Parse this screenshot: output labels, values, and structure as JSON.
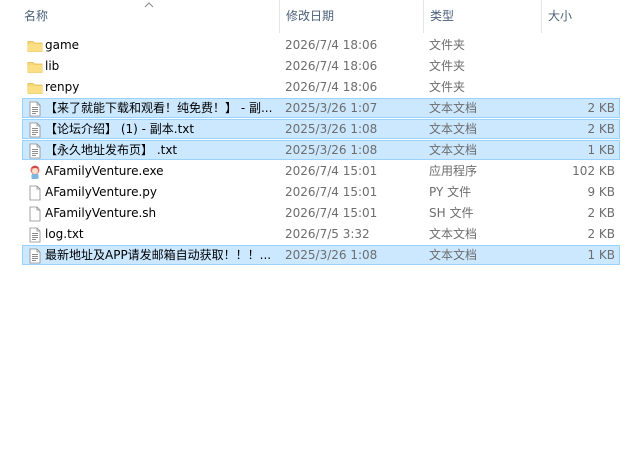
{
  "columns": {
    "name": "名称",
    "date": "修改日期",
    "type": "类型",
    "size": "大小"
  },
  "files": [
    {
      "name": "game",
      "date": "2026/7/4 18:06",
      "type": "文件夹",
      "size": "",
      "icon": "folder-icon",
      "selected": false
    },
    {
      "name": "lib",
      "date": "2026/7/4 18:06",
      "type": "文件夹",
      "size": "",
      "icon": "folder-icon",
      "selected": false
    },
    {
      "name": "renpy",
      "date": "2026/7/4 18:06",
      "type": "文件夹",
      "size": "",
      "icon": "folder-icon",
      "selected": false
    },
    {
      "name": "【来了就能下载和观看！纯免费！】 - 副...",
      "date": "2025/3/26 1:07",
      "type": "文本文档",
      "size": "2 KB",
      "icon": "text-file-icon",
      "selected": true
    },
    {
      "name": "【论坛介绍】 (1) - 副本.txt",
      "date": "2025/3/26 1:08",
      "type": "文本文档",
      "size": "2 KB",
      "icon": "text-file-icon",
      "selected": true
    },
    {
      "name": "【永久地址发布页】 .txt",
      "date": "2025/3/26 1:08",
      "type": "文本文档",
      "size": "1 KB",
      "icon": "text-file-icon",
      "selected": true
    },
    {
      "name": "AFamilyVenture.exe",
      "date": "2026/7/4 15:01",
      "type": "应用程序",
      "size": "102 KB",
      "icon": "app-icon",
      "selected": false
    },
    {
      "name": "AFamilyVenture.py",
      "date": "2026/7/4 15:01",
      "type": "PY 文件",
      "size": "9 KB",
      "icon": "blank-file-icon",
      "selected": false
    },
    {
      "name": "AFamilyVenture.sh",
      "date": "2026/7/4 15:01",
      "type": "SH 文件",
      "size": "2 KB",
      "icon": "blank-file-icon",
      "selected": false
    },
    {
      "name": "log.txt",
      "date": "2026/7/5 3:32",
      "type": "文本文档",
      "size": "2 KB",
      "icon": "text-file-icon",
      "selected": false
    },
    {
      "name": "最新地址及APP请发邮箱自动获取！！！...",
      "date": "2025/3/26 1:08",
      "type": "文本文档",
      "size": "1 KB",
      "icon": "text-file-icon",
      "selected": true
    }
  ],
  "colors": {
    "selection": "#cce8ff",
    "selection_border": "#99d1ff",
    "folder": "#f8d775",
    "header_text": "#4c607a"
  }
}
